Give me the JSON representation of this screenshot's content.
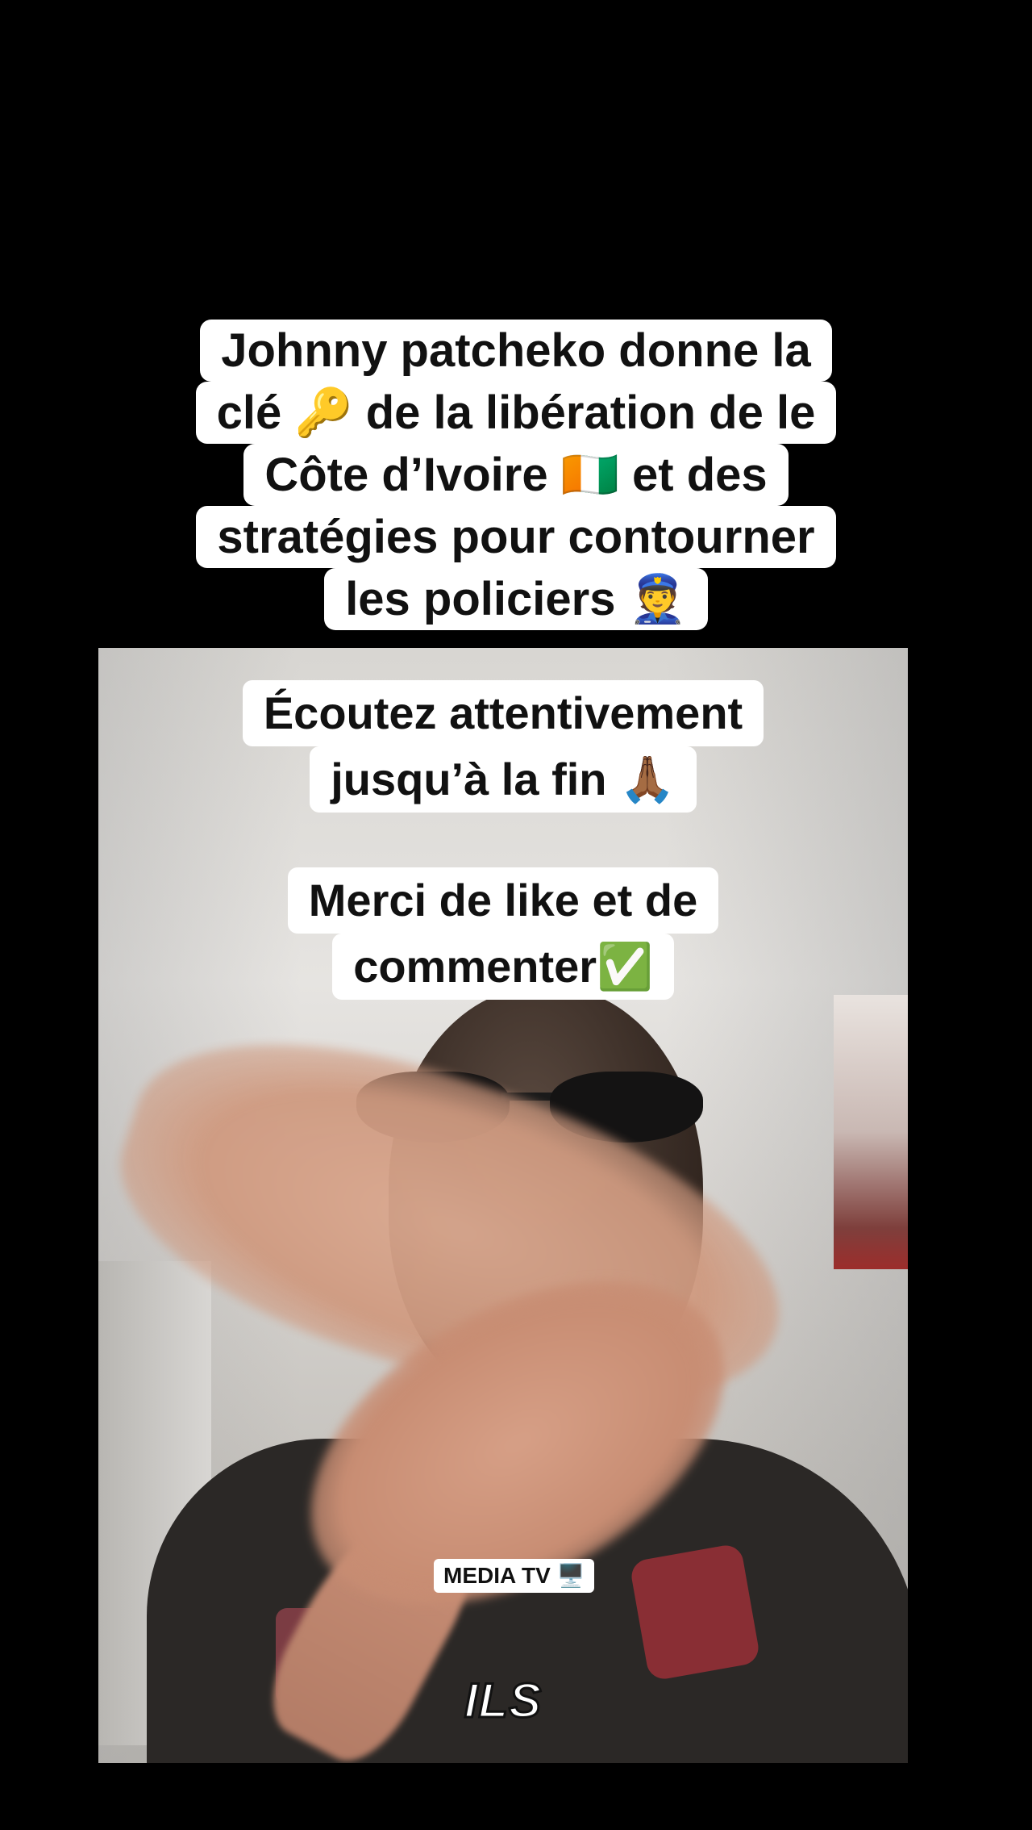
{
  "top_caption": {
    "lines": [
      "Johnny patcheko donne la",
      "clé 🔑 de  la libération de le",
      "Côte d’Ivoire 🇨🇮 et des",
      "stratégies pour contourner",
      "les policiers 👮"
    ]
  },
  "video": {
    "caption_1": {
      "lines": [
        "Écoutez attentivement",
        "jusqu’à la fin 🙏🏾"
      ]
    },
    "caption_2": {
      "lines": [
        "Merci de like et de",
        "commenter✅"
      ]
    },
    "badge": "MEDIA TV 🖥️",
    "subtitle_word": "ILS"
  },
  "colors": {
    "background": "#000000",
    "caption_bg": "#ffffff",
    "caption_text": "#111111"
  }
}
